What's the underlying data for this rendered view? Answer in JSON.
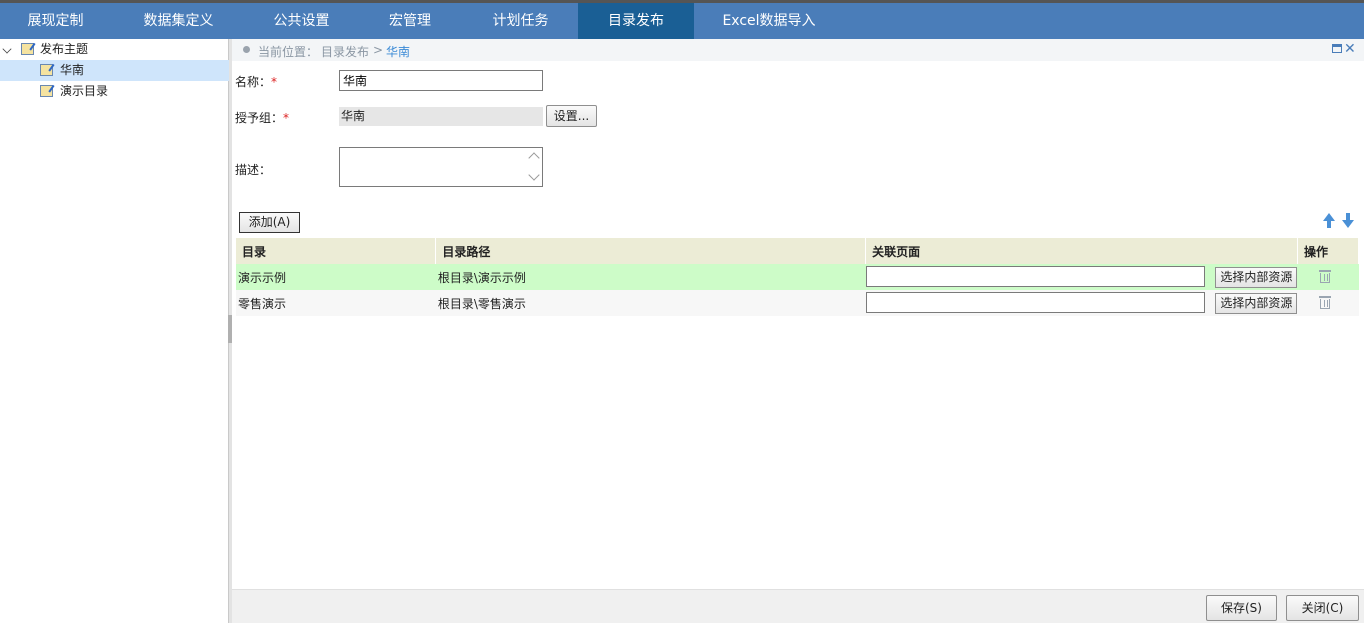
{
  "nav": {
    "items": [
      {
        "label": "展现定制"
      },
      {
        "label": "数据集定义"
      },
      {
        "label": "公共设置"
      },
      {
        "label": "宏管理"
      },
      {
        "label": "计划任务"
      },
      {
        "label": "目录发布"
      },
      {
        "label": "Excel数据导入"
      }
    ],
    "active_label": "目录发布"
  },
  "tree": {
    "root_label": "发布主题",
    "children": [
      {
        "label": "华南",
        "selected": true
      },
      {
        "label": "演示目录",
        "selected": false
      }
    ]
  },
  "breadcrumb": {
    "prefix": "当前位置：",
    "items": [
      "目录发布"
    ],
    "separator": ">",
    "current": "华南"
  },
  "form": {
    "name_label": "名称：",
    "name_value": "华南",
    "group_label": "授予组：",
    "group_value": "华南",
    "settings_button": "设置...",
    "desc_label": "描述：",
    "desc_value": "",
    "required_mark": "*"
  },
  "toolbar": {
    "add_button": "添加(A)",
    "up_icon": "arrow-up-icon",
    "down_icon": "arrow-down-icon"
  },
  "table": {
    "columns": [
      "目录",
      "目录路径",
      "关联页面",
      "操作"
    ],
    "rows": [
      {
        "directory": "演示示例",
        "path": "根目录\\演示示例",
        "page": "",
        "select_button": "选择内部资源"
      },
      {
        "directory": "零售演示",
        "path": "根目录\\零售演示",
        "page": "",
        "select_button": "选择内部资源"
      }
    ]
  },
  "footer": {
    "save_button": "保存(S)",
    "close_button": "关闭(C)"
  },
  "colors": {
    "nav_bg": "#4a7db9",
    "nav_active": "#1a5f95",
    "row_highlight": "#cdfcc8",
    "header_bg": "#ececd6",
    "tree_selected": "#cfe5fb"
  }
}
